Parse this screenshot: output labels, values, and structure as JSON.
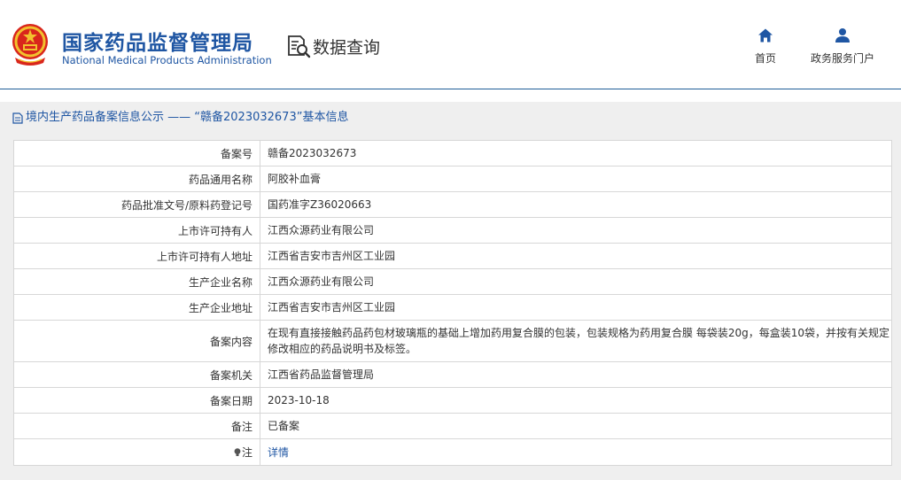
{
  "header": {
    "brand_cn": "国家药品监督管理局",
    "brand_en": "National Medical Products Administration",
    "section": "数据查询",
    "nav": [
      {
        "label": "首页",
        "icon": "home-icon"
      },
      {
        "label": "政务服务门户",
        "icon": "user-icon"
      }
    ]
  },
  "panel": {
    "title": "境内生产药品备案信息公示 —— “赣备2023032673”基本信息"
  },
  "rows": [
    {
      "label": "备案号",
      "value": "赣备2023032673"
    },
    {
      "label": "药品通用名称",
      "value": "阿胶补血膏"
    },
    {
      "label": "药品批准文号/原料药登记号",
      "value": "国药准字Z36020663"
    },
    {
      "label": "上市许可持有人",
      "value": "江西众源药业有限公司"
    },
    {
      "label": "上市许可持有人地址",
      "value": "江西省吉安市吉州区工业园"
    },
    {
      "label": "生产企业名称",
      "value": "江西众源药业有限公司"
    },
    {
      "label": "生产企业地址",
      "value": "江西省吉安市吉州区工业园"
    },
    {
      "label": "备案内容",
      "value": "在现有直接接触药品药包材玻璃瓶的基础上增加药用复合膜的包装，包装规格为药用复合膜 每袋装20g，每盒装10袋，并按有关规定修改相应的药品说明书及标签。"
    },
    {
      "label": "备案机关",
      "value": "江西省药品监督管理局"
    },
    {
      "label": "备案日期",
      "value": "2023-10-18"
    },
    {
      "label": "备注",
      "value": "已备案"
    }
  ],
  "note_row": {
    "label": "注",
    "link": "详情",
    "icon": "lightbulb-icon"
  },
  "colors": {
    "brand": "#1f56a3",
    "header_line": "#1f5e97",
    "panel_bg": "#efefef"
  }
}
